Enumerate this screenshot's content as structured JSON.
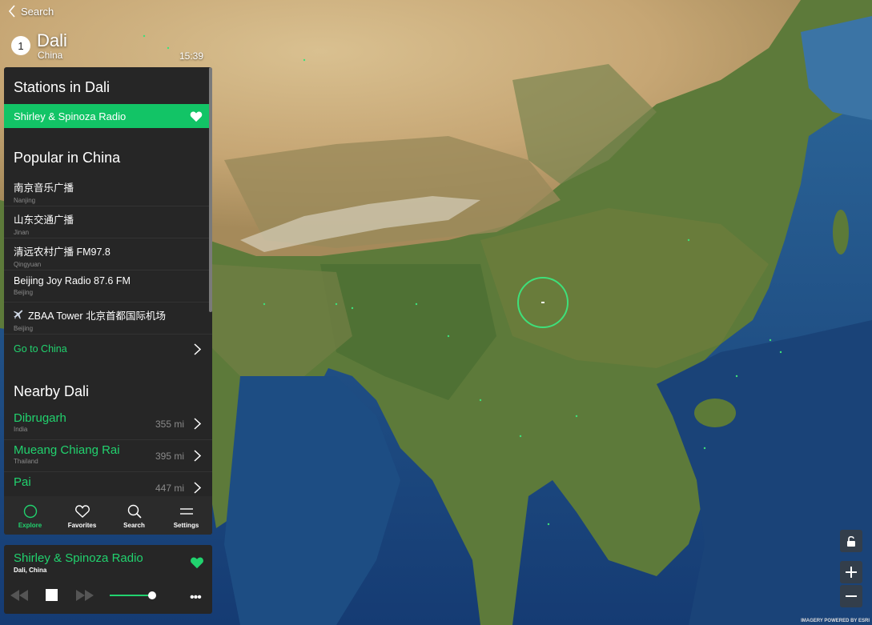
{
  "header": {
    "back_label": "Search",
    "location_index": "1",
    "city": "Dali",
    "country": "China",
    "time": "15:39"
  },
  "stations": {
    "title": "Stations in Dali",
    "active_station": "Shirley & Spinoza Radio"
  },
  "popular": {
    "title": "Popular in China",
    "items": [
      {
        "name": "南京音乐广播",
        "city": "Nanjing"
      },
      {
        "name": "山东交通广播",
        "city": "Jinan"
      },
      {
        "name": "清远农村广播 FM97.8",
        "city": "Qingyuan"
      },
      {
        "name": "Beijing Joy Radio 87.6 FM",
        "city": "Beijing"
      },
      {
        "name": "ZBAA Tower 北京首都国际机场",
        "city": "Beijing",
        "icon": "airplane-icon"
      }
    ],
    "go_label": "Go to China"
  },
  "nearby": {
    "title": "Nearby Dali",
    "items": [
      {
        "name": "Dibrugarh",
        "country": "India",
        "distance": "355 mi"
      },
      {
        "name": "Mueang Chiang Rai",
        "country": "Thailand",
        "distance": "395 mi"
      },
      {
        "name": "Pai",
        "country": "",
        "distance": "447 mi"
      }
    ]
  },
  "tabs": [
    {
      "label": "Explore",
      "icon": "explore-circle-icon",
      "active": true
    },
    {
      "label": "Favorites",
      "icon": "heart-icon",
      "active": false
    },
    {
      "label": "Search",
      "icon": "search-icon",
      "active": false
    },
    {
      "label": "Settings",
      "icon": "settings-lines-icon",
      "active": false
    }
  ],
  "player": {
    "title": "Shirley & Spinoza Radio",
    "location": "Dali, China",
    "volume": 0.95
  },
  "map": {
    "attribution": "IMAGERY POWERED BY ESRI"
  },
  "colors": {
    "accent": "#21d26e",
    "panel": "#262626"
  }
}
